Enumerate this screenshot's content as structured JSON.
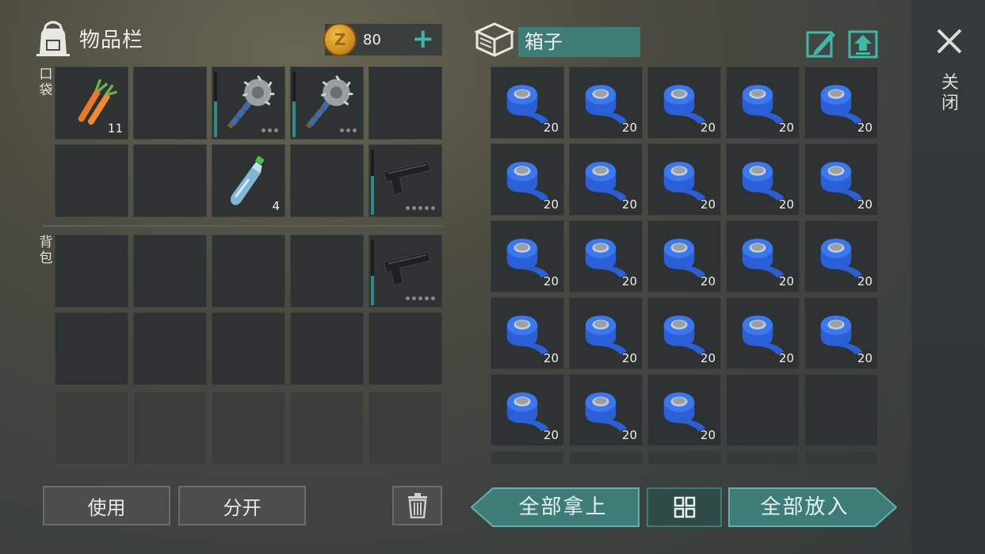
{
  "inventory": {
    "title": "物品栏",
    "coins": "80",
    "pocket_label": "口袋",
    "backpack_label": "背包",
    "pocket_slots": [
      {
        "item": "carrot",
        "qty": "11"
      },
      {
        "item": "",
        "qty": ""
      },
      {
        "item": "saw-mace",
        "qty": "",
        "durability": 0.55
      },
      {
        "item": "saw-mace",
        "qty": "",
        "durability": 0.55
      },
      {
        "item": "",
        "qty": ""
      },
      {
        "item": "",
        "qty": ""
      },
      {
        "item": "",
        "qty": ""
      },
      {
        "item": "water-bottle",
        "qty": "4"
      },
      {
        "item": "",
        "qty": ""
      },
      {
        "item": "pistol",
        "qty": "",
        "durability": 0.6
      }
    ],
    "backpack_slots": [
      {
        "item": "",
        "qty": ""
      },
      {
        "item": "",
        "qty": ""
      },
      {
        "item": "",
        "qty": ""
      },
      {
        "item": "",
        "qty": ""
      },
      {
        "item": "pistol",
        "qty": "",
        "durability": 0.45
      },
      {
        "item": "",
        "qty": ""
      },
      {
        "item": "",
        "qty": ""
      },
      {
        "item": "",
        "qty": ""
      },
      {
        "item": "",
        "qty": ""
      },
      {
        "item": "",
        "qty": ""
      }
    ]
  },
  "box": {
    "name": "箱子",
    "close_label": "关闭",
    "slots": [
      {
        "item": "blue-tape",
        "qty": "20"
      },
      {
        "item": "blue-tape",
        "qty": "20"
      },
      {
        "item": "blue-tape",
        "qty": "20"
      },
      {
        "item": "blue-tape",
        "qty": "20"
      },
      {
        "item": "blue-tape",
        "qty": "20"
      },
      {
        "item": "blue-tape",
        "qty": "20"
      },
      {
        "item": "blue-tape",
        "qty": "20"
      },
      {
        "item": "blue-tape",
        "qty": "20"
      },
      {
        "item": "blue-tape",
        "qty": "20"
      },
      {
        "item": "blue-tape",
        "qty": "20"
      },
      {
        "item": "blue-tape",
        "qty": "20"
      },
      {
        "item": "blue-tape",
        "qty": "20"
      },
      {
        "item": "blue-tape",
        "qty": "20"
      },
      {
        "item": "blue-tape",
        "qty": "20"
      },
      {
        "item": "blue-tape",
        "qty": "20"
      },
      {
        "item": "blue-tape",
        "qty": "20"
      },
      {
        "item": "blue-tape",
        "qty": "20"
      },
      {
        "item": "blue-tape",
        "qty": "20"
      },
      {
        "item": "blue-tape",
        "qty": "20"
      },
      {
        "item": "blue-tape",
        "qty": "20"
      },
      {
        "item": "blue-tape",
        "qty": "20"
      },
      {
        "item": "blue-tape",
        "qty": "20"
      },
      {
        "item": "blue-tape",
        "qty": "20"
      },
      {
        "item": "",
        "qty": ""
      },
      {
        "item": "",
        "qty": ""
      }
    ]
  },
  "buttons": {
    "use": "使用",
    "split": "分开",
    "take_all": "全部拿上",
    "put_all": "全部放入"
  },
  "icons": {
    "backpack": "backpack-icon",
    "coin": "coin-icon",
    "add": "plus-icon",
    "box": "box-icon",
    "rename": "edit-icon",
    "upload": "upload-icon",
    "close": "close-icon",
    "trash": "trash-icon",
    "sort": "grid-sort-icon"
  },
  "colors": {
    "accent": "#3fb8a8",
    "teal_button": "#3e7c78",
    "cell": "#2e3233"
  }
}
